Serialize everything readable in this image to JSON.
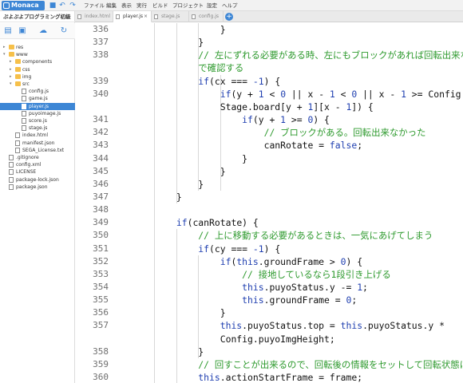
{
  "app": {
    "brand": "Monaca",
    "menu": [
      "ファイル",
      "編集",
      "表示",
      "実行",
      "ビルド",
      "プロジェクト",
      "設定",
      "ヘルプ"
    ]
  },
  "project": {
    "title": "ぷよぷよプログラミング初級"
  },
  "tree": [
    {
      "label": "res",
      "type": "folder",
      "depth": 0,
      "arrow": "▸"
    },
    {
      "label": "www",
      "type": "folder",
      "depth": 0,
      "arrow": "▾"
    },
    {
      "label": "components",
      "type": "folder",
      "depth": 1,
      "arrow": "▸"
    },
    {
      "label": "css",
      "type": "folder",
      "depth": 1,
      "arrow": "▸"
    },
    {
      "label": "img",
      "type": "folder",
      "depth": 1,
      "arrow": "▸"
    },
    {
      "label": "src",
      "type": "folder",
      "depth": 1,
      "arrow": "▾"
    },
    {
      "label": "config.js",
      "type": "file",
      "depth": 2
    },
    {
      "label": "game.js",
      "type": "file",
      "depth": 2
    },
    {
      "label": "player.js",
      "type": "file",
      "depth": 2,
      "selected": true
    },
    {
      "label": "puyoimage.js",
      "type": "file",
      "depth": 2
    },
    {
      "label": "score.js",
      "type": "file",
      "depth": 2
    },
    {
      "label": "stage.js",
      "type": "file",
      "depth": 2
    },
    {
      "label": "index.html",
      "type": "file",
      "depth": 1
    },
    {
      "label": "manifest.json",
      "type": "file",
      "depth": 1
    },
    {
      "label": "SEGA_License.txt",
      "type": "file",
      "depth": 1
    },
    {
      "label": ".gitignore",
      "type": "file",
      "depth": 0
    },
    {
      "label": "config.xml",
      "type": "file",
      "depth": 0
    },
    {
      "label": "LICENSE",
      "type": "file",
      "depth": 0
    },
    {
      "label": "package-lock.json",
      "type": "file",
      "depth": 0
    },
    {
      "label": "package.json",
      "type": "file",
      "depth": 0
    }
  ],
  "tabs": [
    {
      "label": "index.html",
      "active": false,
      "close": ""
    },
    {
      "label": "player.js",
      "active": true,
      "close": "×"
    },
    {
      "label": "stage.js",
      "active": false,
      "close": ""
    },
    {
      "label": "config.js",
      "active": false,
      "close": ""
    }
  ],
  "tab_add_label": "+",
  "colors": {
    "accent": "#3d86d5",
    "keyword": "#1f3fb0",
    "comment": "#2e9a2e"
  },
  "code": [
    {
      "n": "336",
      "t": [
        [
          "",
          "                }"
        ]
      ]
    },
    {
      "n": "337",
      "t": [
        [
          "",
          "            }"
        ]
      ]
    },
    {
      "n": "338",
      "t": [
        [
          "cm",
          "            // 左にずれる必要がある時、左にもブロックがあれば回転出来ないの"
        ]
      ]
    },
    {
      "n": "",
      "t": [
        [
          "cm",
          "            で確認する"
        ]
      ]
    },
    {
      "n": "339",
      "t": [
        [
          "",
          "            "
        ],
        [
          "kw",
          "if"
        ],
        [
          "",
          "(cx === "
        ],
        [
          "num",
          "-1"
        ],
        [
          "",
          ") {"
        ]
      ]
    },
    {
      "n": "340",
      "t": [
        [
          "",
          "                "
        ],
        [
          "kw",
          "if"
        ],
        [
          "",
          "(y + "
        ],
        [
          "num",
          "1"
        ],
        [
          "",
          " < "
        ],
        [
          "num",
          "0"
        ],
        [
          "",
          " || x - "
        ],
        [
          "num",
          "1"
        ],
        [
          "",
          " < "
        ],
        [
          "num",
          "0"
        ],
        [
          "",
          " || x - "
        ],
        [
          "num",
          "1"
        ],
        [
          "",
          " >= Config.stageCols ||"
        ]
      ]
    },
    {
      "n": "",
      "t": [
        [
          "",
          "                Stage.board[y + "
        ],
        [
          "num",
          "1"
        ],
        [
          "",
          "][x - "
        ],
        [
          "num",
          "1"
        ],
        [
          "",
          "]) {"
        ]
      ]
    },
    {
      "n": "341",
      "t": [
        [
          "",
          "                    "
        ],
        [
          "kw",
          "if"
        ],
        [
          "",
          "(y + "
        ],
        [
          "num",
          "1"
        ],
        [
          "",
          " >= "
        ],
        [
          "num",
          "0"
        ],
        [
          "",
          ") {"
        ]
      ]
    },
    {
      "n": "342",
      "t": [
        [
          "cm",
          "                        // ブロックがある。回転出来なかった"
        ]
      ]
    },
    {
      "n": "343",
      "t": [
        [
          "",
          "                        canRotate = "
        ],
        [
          "kw",
          "false"
        ],
        [
          "",
          ";"
        ]
      ]
    },
    {
      "n": "344",
      "t": [
        [
          "",
          "                    }"
        ]
      ]
    },
    {
      "n": "345",
      "t": [
        [
          "",
          "                }"
        ]
      ]
    },
    {
      "n": "346",
      "t": [
        [
          "",
          "            }"
        ]
      ]
    },
    {
      "n": "347",
      "t": [
        [
          "",
          "        }"
        ]
      ]
    },
    {
      "n": "348",
      "t": [
        [
          "",
          ""
        ]
      ]
    },
    {
      "n": "349",
      "t": [
        [
          "",
          "        "
        ],
        [
          "kw",
          "if"
        ],
        [
          "",
          "(canRotate) {"
        ]
      ]
    },
    {
      "n": "350",
      "t": [
        [
          "cm",
          "            // 上に移動する必要があるときは、一気にあげてしまう"
        ]
      ]
    },
    {
      "n": "351",
      "t": [
        [
          "",
          "            "
        ],
        [
          "kw",
          "if"
        ],
        [
          "",
          "(cy === "
        ],
        [
          "num",
          "-1"
        ],
        [
          "",
          ") {"
        ]
      ]
    },
    {
      "n": "352",
      "t": [
        [
          "",
          "                "
        ],
        [
          "kw",
          "if"
        ],
        [
          "",
          "("
        ],
        [
          "kw",
          "this"
        ],
        [
          "",
          ".groundFrame > "
        ],
        [
          "num",
          "0"
        ],
        [
          "",
          ") {"
        ]
      ]
    },
    {
      "n": "353",
      "t": [
        [
          "cm",
          "                    // 接地しているなら1段引き上げる"
        ]
      ]
    },
    {
      "n": "354",
      "t": [
        [
          "",
          "                    "
        ],
        [
          "kw",
          "this"
        ],
        [
          "",
          ".puyoStatus.y -= "
        ],
        [
          "num",
          "1"
        ],
        [
          "",
          ";"
        ]
      ]
    },
    {
      "n": "355",
      "t": [
        [
          "",
          "                    "
        ],
        [
          "kw",
          "this"
        ],
        [
          "",
          ".groundFrame = "
        ],
        [
          "num",
          "0"
        ],
        [
          "",
          ";"
        ]
      ]
    },
    {
      "n": "356",
      "t": [
        [
          "",
          "                }"
        ]
      ]
    },
    {
      "n": "357",
      "t": [
        [
          "",
          "                "
        ],
        [
          "kw",
          "this"
        ],
        [
          "",
          ".puyoStatus.top = "
        ],
        [
          "kw",
          "this"
        ],
        [
          "",
          ".puyoStatus.y *"
        ]
      ]
    },
    {
      "n": "",
      "t": [
        [
          "",
          "                Config.puyoImgHeight;"
        ]
      ]
    },
    {
      "n": "358",
      "t": [
        [
          "",
          "            }"
        ]
      ]
    },
    {
      "n": "359",
      "t": [
        [
          "cm",
          "            // 回すことが出来るので、回転後の情報をセットして回転状態にする"
        ]
      ]
    },
    {
      "n": "360",
      "t": [
        [
          "",
          "            "
        ],
        [
          "kw",
          "this"
        ],
        [
          "",
          ".actionStartFrame = frame;"
        ]
      ]
    }
  ]
}
